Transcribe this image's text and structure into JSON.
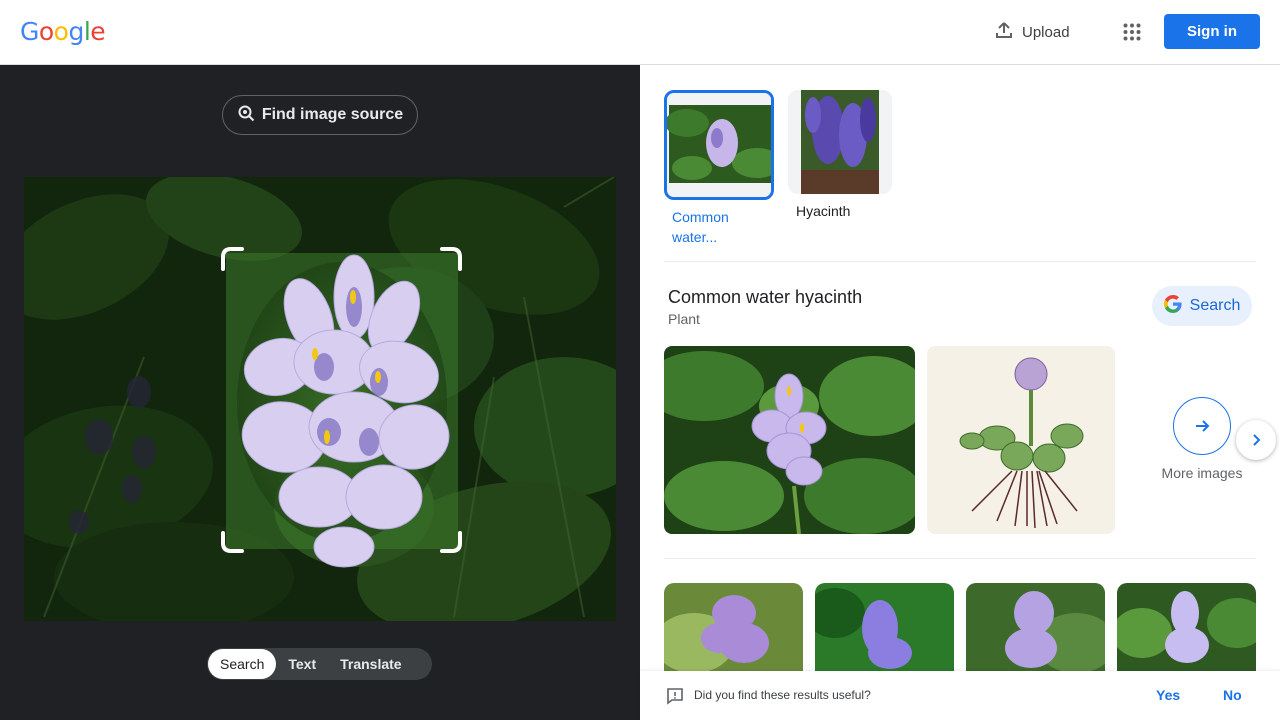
{
  "header": {
    "logo_letters": [
      {
        "char": "G",
        "color": "#4285f4"
      },
      {
        "char": "o",
        "color": "#ea4335"
      },
      {
        "char": "o",
        "color": "#fbbc05"
      },
      {
        "char": "g",
        "color": "#4285f4"
      },
      {
        "char": "l",
        "color": "#34a853"
      },
      {
        "char": "e",
        "color": "#ea4335"
      }
    ],
    "upload_label": "Upload",
    "apps_icon": "apps-grid-icon",
    "signin_label": "Sign in"
  },
  "lens": {
    "find_source_label": "Find image source",
    "modes": [
      "Search",
      "Text",
      "Translate"
    ],
    "active_mode": "Search"
  },
  "visual_matches": [
    {
      "label": "Common water...",
      "selected": true
    },
    {
      "label": "Hyacinth",
      "selected": false
    }
  ],
  "entity": {
    "title": "Common water hyacinth",
    "subtitle": "Plant",
    "search_label": "Search",
    "more_images_label": "More images"
  },
  "feedback": {
    "question": "Did you find these results useful?",
    "yes": "Yes",
    "no": "No"
  },
  "colors": {
    "accent": "#1a73e8",
    "dark_bg": "#202124"
  }
}
